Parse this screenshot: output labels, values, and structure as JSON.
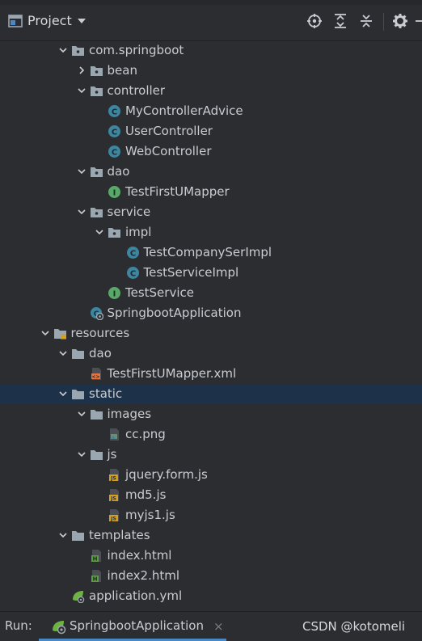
{
  "header": {
    "title": "Project",
    "icons": [
      "project-view-icon",
      "dropdown-arrow-icon",
      "locate-icon",
      "expand-all-icon",
      "collapse-all-icon",
      "settings-icon",
      "hide-icon"
    ]
  },
  "tree": [
    {
      "label": "com.springboot",
      "indent": 4,
      "expanded": true,
      "icon": "package"
    },
    {
      "label": "bean",
      "indent": 5,
      "expanded": false,
      "icon": "package"
    },
    {
      "label": "controller",
      "indent": 5,
      "expanded": true,
      "icon": "package"
    },
    {
      "label": "MyControllerAdvice",
      "indent": 6,
      "icon": "class"
    },
    {
      "label": "UserController",
      "indent": 6,
      "icon": "class"
    },
    {
      "label": "WebController",
      "indent": 6,
      "icon": "class"
    },
    {
      "label": "dao",
      "indent": 5,
      "expanded": true,
      "icon": "package"
    },
    {
      "label": "TestFirstUMapper",
      "indent": 6,
      "icon": "interface"
    },
    {
      "label": "service",
      "indent": 5,
      "expanded": true,
      "icon": "package"
    },
    {
      "label": "impl",
      "indent": 6,
      "expanded": true,
      "icon": "package"
    },
    {
      "label": "TestCompanySerImpl",
      "indent": 7,
      "icon": "class"
    },
    {
      "label": "TestServiceImpl",
      "indent": 7,
      "icon": "class"
    },
    {
      "label": "TestService",
      "indent": 6,
      "icon": "interface"
    },
    {
      "label": "SpringbootApplication",
      "indent": 5,
      "icon": "spring-class"
    },
    {
      "label": "resources",
      "indent": 3,
      "expanded": true,
      "icon": "resources-folder"
    },
    {
      "label": "dao",
      "indent": 4,
      "expanded": true,
      "icon": "folder"
    },
    {
      "label": "TestFirstUMapper.xml",
      "indent": 5,
      "icon": "xml"
    },
    {
      "label": "static",
      "indent": 4,
      "expanded": true,
      "icon": "folder",
      "selected": true
    },
    {
      "label": "images",
      "indent": 5,
      "expanded": true,
      "icon": "folder"
    },
    {
      "label": "cc.png",
      "indent": 6,
      "icon": "image"
    },
    {
      "label": "js",
      "indent": 5,
      "expanded": true,
      "icon": "folder"
    },
    {
      "label": "jquery.form.js",
      "indent": 6,
      "icon": "js"
    },
    {
      "label": "md5.js",
      "indent": 6,
      "icon": "js"
    },
    {
      "label": "myjs1.js",
      "indent": 6,
      "icon": "js"
    },
    {
      "label": "templates",
      "indent": 4,
      "expanded": true,
      "icon": "folder"
    },
    {
      "label": "index.html",
      "indent": 5,
      "icon": "html"
    },
    {
      "label": "index2.html",
      "indent": 5,
      "icon": "html"
    },
    {
      "label": "application.yml",
      "indent": 4,
      "icon": "yml"
    }
  ],
  "run": {
    "label": "Run:",
    "tab_label": "SpringbootApplication",
    "close_glyph": "×"
  },
  "watermark": "CSDN @kotomeli",
  "colors": {
    "class": "#3e86a0",
    "interface": "#59a869",
    "folder": "#9aa7b0",
    "selection": "#1d3248",
    "js": "#d4a017",
    "html": "#5e9c46",
    "xml": "#e07543",
    "accent": "#4a88c7"
  }
}
